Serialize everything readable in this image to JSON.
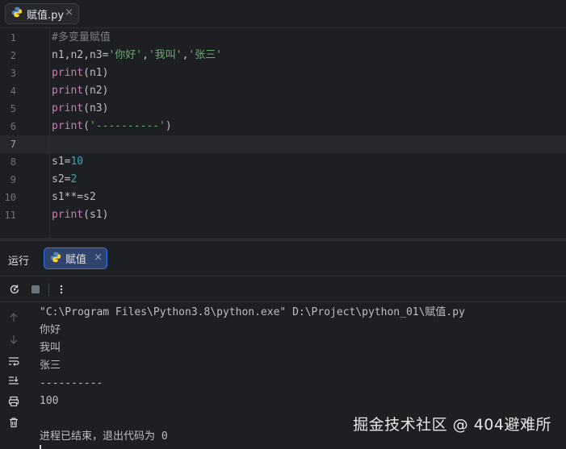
{
  "editor_tab": {
    "filename": "赋值.py",
    "close": "×"
  },
  "code_lines": [
    {
      "n": "1",
      "parts": [
        {
          "t": "#多变量赋值",
          "k": "comment"
        }
      ]
    },
    {
      "n": "2",
      "parts": [
        {
          "t": "n1,n2,n3=",
          "k": "plain"
        },
        {
          "t": "'你好'",
          "k": "str"
        },
        {
          "t": ",",
          "k": "plain"
        },
        {
          "t": "'我叫'",
          "k": "str"
        },
        {
          "t": ",",
          "k": "plain"
        },
        {
          "t": "'张三'",
          "k": "str"
        }
      ]
    },
    {
      "n": "3",
      "parts": [
        {
          "t": "print",
          "k": "fn"
        },
        {
          "t": "(n1)",
          "k": "plain"
        }
      ]
    },
    {
      "n": "4",
      "parts": [
        {
          "t": "print",
          "k": "fn"
        },
        {
          "t": "(n2)",
          "k": "plain"
        }
      ]
    },
    {
      "n": "5",
      "parts": [
        {
          "t": "print",
          "k": "fn"
        },
        {
          "t": "(n3)",
          "k": "plain"
        }
      ]
    },
    {
      "n": "6",
      "parts": [
        {
          "t": "print",
          "k": "fn"
        },
        {
          "t": "(",
          "k": "plain"
        },
        {
          "t": "'----------'",
          "k": "str"
        },
        {
          "t": ")",
          "k": "plain"
        }
      ]
    },
    {
      "n": "7",
      "parts": [],
      "active": true
    },
    {
      "n": "8",
      "parts": [
        {
          "t": "s1=",
          "k": "plain"
        },
        {
          "t": "10",
          "k": "num"
        }
      ]
    },
    {
      "n": "9",
      "parts": [
        {
          "t": "s2=",
          "k": "plain"
        },
        {
          "t": "2",
          "k": "num"
        }
      ]
    },
    {
      "n": "10",
      "parts": [
        {
          "t": "s1**=s2",
          "k": "plain"
        }
      ]
    },
    {
      "n": "11",
      "parts": [
        {
          "t": "print",
          "k": "fn"
        },
        {
          "t": "(s1)",
          "k": "plain"
        }
      ]
    }
  ],
  "run_panel": {
    "title": "运行",
    "tab_label": "赋值",
    "tab_close": "×"
  },
  "console_lines": [
    "\"C:\\Program Files\\Python3.8\\python.exe\" D:\\Project\\python_01\\赋值.py",
    "你好",
    "我叫",
    "张三",
    "----------",
    "100",
    "",
    "进程已结束，退出代码为 0"
  ],
  "watermark": "掘金技术社区 @ 404避难所",
  "colors": {
    "background": "#1e1f22",
    "string": "#6aab73",
    "number": "#2aacb8",
    "function": "#c77dbb",
    "comment": "#7a7e85",
    "accent": "#3574f0"
  },
  "icons": {
    "editor_tab": "python-file-icon",
    "run_tab": "python-file-icon",
    "toolbar": [
      "rerun-icon",
      "stop-icon",
      "more-vertical-icon"
    ],
    "side": [
      "scroll-up-icon",
      "scroll-down-icon",
      "soft-wrap-icon",
      "scroll-to-end-icon",
      "print-icon",
      "trash-icon"
    ]
  }
}
